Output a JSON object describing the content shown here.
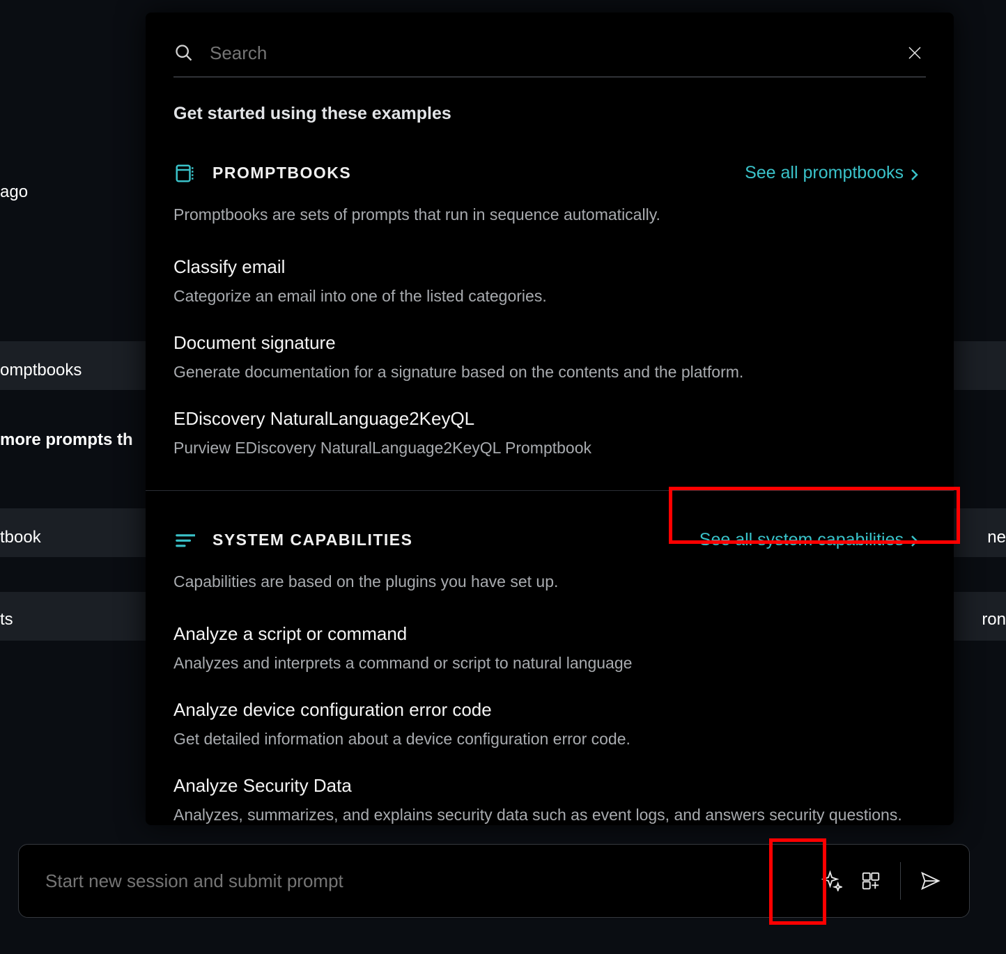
{
  "search": {
    "placeholder": "Search"
  },
  "subtitle": "Get started using these examples",
  "promptbooks": {
    "heading": "PROMPTBOOKS",
    "see_all": "See all promptbooks",
    "description": "Promptbooks are sets of prompts that run in sequence automatically.",
    "items": [
      {
        "title": "Classify email",
        "desc": "Categorize an email into one of the listed categories."
      },
      {
        "title": "Document signature",
        "desc": "Generate documentation for a signature based on the contents and the platform."
      },
      {
        "title": "EDiscovery NaturalLanguage2KeyQL",
        "desc": "Purview EDiscovery NaturalLanguage2KeyQL Promptbook"
      }
    ]
  },
  "capabilities": {
    "heading": "SYSTEM CAPABILITIES",
    "see_all": "See all system capabilities",
    "description": "Capabilities are based on the plugins you have set up.",
    "items": [
      {
        "title": "Analyze a script or command",
        "desc": "Analyzes and interprets a command or script to natural language"
      },
      {
        "title": "Analyze device configuration error code",
        "desc": "Get detailed information about a device configuration error code."
      },
      {
        "title": "Analyze Security Data",
        "desc": "Analyzes, summarizes, and explains security data such as event logs, and answers security questions."
      }
    ]
  },
  "prompt_input": {
    "placeholder": "Start new session and submit prompt"
  },
  "bg": {
    "ago": "ago",
    "omptbooks": "omptbooks",
    "more_prompts": "more prompts th",
    "tbook": "tbook",
    "ts": "ts",
    "ne": "ne",
    "ron": "ron"
  }
}
